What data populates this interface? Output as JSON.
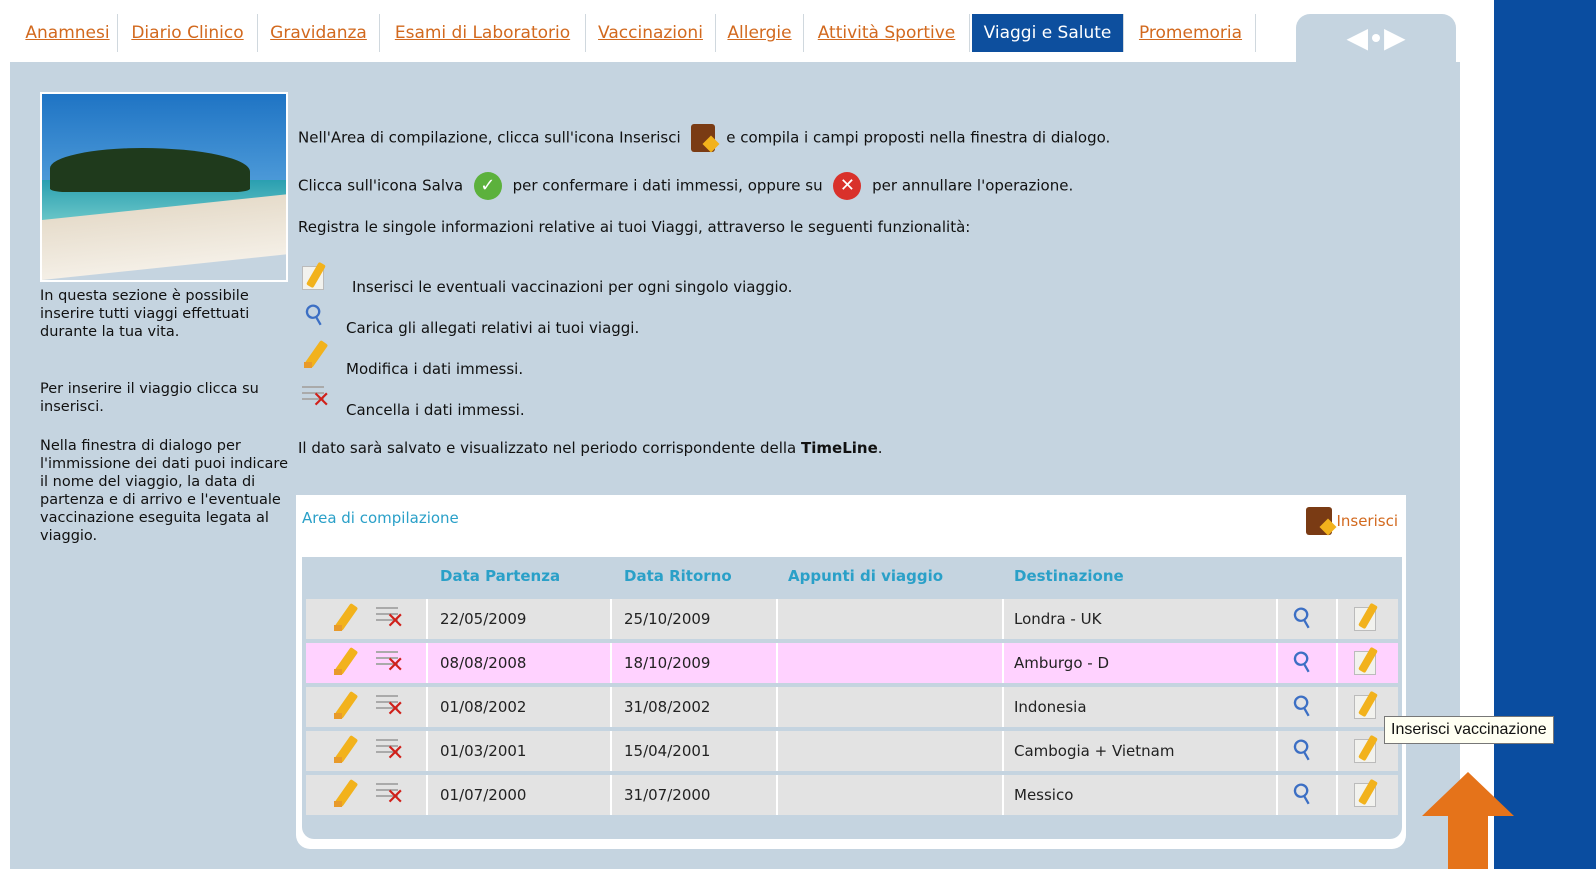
{
  "tabs": [
    {
      "label": "Anamnesi"
    },
    {
      "label": "Diario Clinico"
    },
    {
      "label": "Gravidanza"
    },
    {
      "label": "Esami di Laboratorio"
    },
    {
      "label": "Vaccinazioni"
    },
    {
      "label": "Allergie"
    },
    {
      "label": "Attività Sportive"
    },
    {
      "label": "Viaggi e Salute",
      "active": true
    },
    {
      "label": "Promemoria"
    }
  ],
  "sidebar": {
    "p1": "In questa sezione è possibile inserire tutti viaggi effettuati durante la tua vita.",
    "p2": "Per inserire il viaggio clicca su inserisci.",
    "p3": "Nella finestra di dialogo per l'immissione dei dati puoi indicare il nome del viaggio, la data di partenza e di arrivo e l'eventuale vaccinazione eseguita legata al viaggio."
  },
  "instructions": {
    "line1_a": "Nell'Area di compilazione, clicca sull'icona Inserisci",
    "line1_b": "e compila i campi proposti nella finestra di dialogo.",
    "line2_a": "Clicca sull'icona Salva",
    "line2_b": "per confermare i dati immessi, oppure su",
    "line2_c": "per annullare l'operazione.",
    "line3": "Registra le singole informazioni relative ai tuoi Viaggi, attraverso le seguenti funzionalità:",
    "legend": [
      {
        "icon": "vaccination-icon",
        "text": "Inserisci le eventuali vaccinazioni per ogni singolo viaggio."
      },
      {
        "icon": "paperclip-icon",
        "text": "Carica gli allegati relativi ai tuoi viaggi."
      },
      {
        "icon": "pencil-icon",
        "text": "Modifica i dati immessi."
      },
      {
        "icon": "delete-icon",
        "text": "Cancella i dati immessi."
      }
    ],
    "footer_a": "Il dato sarà salvato e visualizzato nel periodo corrispondente della",
    "footer_b": "TimeLine",
    "footer_c": "."
  },
  "area": {
    "title": "Area di compilazione",
    "insert_label": "Inserisci",
    "columns": [
      "Data Partenza",
      "Data Ritorno",
      "Appunti di viaggio",
      "Destinazione"
    ],
    "rows": [
      {
        "partenza": "22/05/2009",
        "ritorno": "25/10/2009",
        "appunti": "",
        "destinazione": "Londra - UK",
        "highlight": false
      },
      {
        "partenza": "08/08/2008",
        "ritorno": "18/10/2009",
        "appunti": "",
        "destinazione": "Amburgo - D",
        "highlight": true
      },
      {
        "partenza": "01/08/2002",
        "ritorno": "31/08/2002",
        "appunti": "",
        "destinazione": "Indonesia",
        "highlight": false
      },
      {
        "partenza": "01/03/2001",
        "ritorno": "15/04/2001",
        "appunti": "",
        "destinazione": "Cambogia + Vietnam",
        "highlight": false
      },
      {
        "partenza": "01/07/2000",
        "ritorno": "31/07/2000",
        "appunti": "",
        "destinazione": "Messico",
        "highlight": false
      }
    ]
  },
  "tooltip": "Inserisci vaccinazione",
  "colors": {
    "accent_blue": "#0d4f9e",
    "link_orange": "#d2691e",
    "header_teal": "#2aa0c8",
    "highlight_pink": "#ffd2ff",
    "pointer_orange": "#e5731a"
  }
}
